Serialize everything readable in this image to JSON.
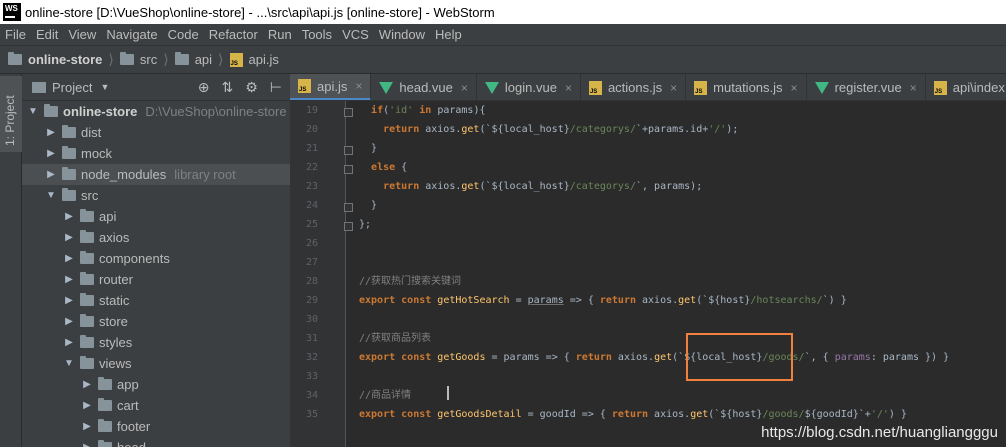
{
  "window": {
    "logo_text": "WS",
    "title": "online-store [D:\\VueShop\\online-store] - ...\\src\\api\\api.js [online-store] - WebStorm"
  },
  "menu": [
    "File",
    "Edit",
    "View",
    "Navigate",
    "Code",
    "Refactor",
    "Run",
    "Tools",
    "VCS",
    "Window",
    "Help"
  ],
  "breadcrumbs": [
    "online-store",
    "src",
    "api",
    "api.js"
  ],
  "sidebar_tab": {
    "label": "1: Project"
  },
  "project_panel": {
    "title": "Project",
    "tree": [
      {
        "label": "online-store",
        "extra": "D:\\VueShop\\online-store",
        "expanded": true,
        "level": 0,
        "bold": true
      },
      {
        "label": "dist",
        "expanded": false,
        "level": 1
      },
      {
        "label": "mock",
        "expanded": false,
        "level": 1
      },
      {
        "label": "node_modules",
        "extra": "library root",
        "expanded": false,
        "level": 1,
        "selected": true
      },
      {
        "label": "src",
        "expanded": true,
        "level": 1
      },
      {
        "label": "api",
        "expanded": false,
        "level": 2
      },
      {
        "label": "axios",
        "expanded": false,
        "level": 2
      },
      {
        "label": "components",
        "expanded": false,
        "level": 2
      },
      {
        "label": "router",
        "expanded": false,
        "level": 2
      },
      {
        "label": "static",
        "expanded": false,
        "level": 2
      },
      {
        "label": "store",
        "expanded": false,
        "level": 2
      },
      {
        "label": "styles",
        "expanded": false,
        "level": 2
      },
      {
        "label": "views",
        "expanded": true,
        "level": 2
      },
      {
        "label": "app",
        "expanded": false,
        "level": 3
      },
      {
        "label": "cart",
        "expanded": false,
        "level": 3
      },
      {
        "label": "footer",
        "expanded": false,
        "level": 3
      },
      {
        "label": "head",
        "expanded": false,
        "level": 3
      }
    ]
  },
  "tabs": [
    {
      "label": "api.js",
      "icon": "js",
      "active": true
    },
    {
      "label": "head.vue",
      "icon": "vue"
    },
    {
      "label": "login.vue",
      "icon": "vue"
    },
    {
      "label": "actions.js",
      "icon": "js"
    },
    {
      "label": "mutations.js",
      "icon": "js"
    },
    {
      "label": "register.vue",
      "icon": "vue"
    },
    {
      "label": "api\\index.js",
      "icon": "js"
    }
  ],
  "editor": {
    "lines": [
      {
        "num": "19",
        "tokens": [
          [
            "",
            "  "
          ],
          [
            "kw",
            "if"
          ],
          [
            "",
            "("
          ],
          [
            "str",
            "'id'"
          ],
          [
            "",
            " "
          ],
          [
            "kw",
            "in"
          ],
          [
            "",
            " params){"
          ]
        ]
      },
      {
        "num": "20",
        "tokens": [
          [
            "",
            "    "
          ],
          [
            "kw",
            "return"
          ],
          [
            "",
            " axios."
          ],
          [
            "fn",
            "get"
          ],
          [
            "",
            "(`${local_host}"
          ],
          [
            "str",
            "/categorys/"
          ],
          [
            "",
            "`+params.id+"
          ],
          [
            "str",
            "'/'"
          ],
          [
            "",
            ");"
          ]
        ]
      },
      {
        "num": "21",
        "tokens": [
          [
            "",
            "  }"
          ]
        ]
      },
      {
        "num": "22",
        "tokens": [
          [
            "",
            "  "
          ],
          [
            "kw",
            "else"
          ],
          [
            "",
            " {"
          ]
        ]
      },
      {
        "num": "23",
        "tokens": [
          [
            "",
            "    "
          ],
          [
            "kw",
            "return"
          ],
          [
            "",
            " axios."
          ],
          [
            "fn",
            "get"
          ],
          [
            "",
            "(`${local_host}"
          ],
          [
            "str",
            "/categorys/"
          ],
          [
            "",
            "`, params);"
          ]
        ]
      },
      {
        "num": "24",
        "tokens": [
          [
            "",
            "  }"
          ]
        ]
      },
      {
        "num": "25",
        "tokens": [
          [
            "",
            "};"
          ]
        ]
      },
      {
        "num": "26",
        "tokens": []
      },
      {
        "num": "27",
        "tokens": []
      },
      {
        "num": "28",
        "tokens": [
          [
            "cm",
            "//获取热门搜索关键词"
          ]
        ]
      },
      {
        "num": "29",
        "tokens": [
          [
            "kw",
            "export"
          ],
          [
            "",
            " "
          ],
          [
            "kw",
            "const"
          ],
          [
            "",
            " "
          ],
          [
            "fn",
            "getHotSearch"
          ],
          [
            "",
            " = "
          ],
          [
            "ul",
            "params"
          ],
          [
            "",
            " => { "
          ],
          [
            "kw",
            "return"
          ],
          [
            "",
            " axios."
          ],
          [
            "fn",
            "get"
          ],
          [
            "",
            "(`${host}"
          ],
          [
            "str",
            "/hotsearchs/"
          ],
          [
            "",
            "`) }"
          ]
        ]
      },
      {
        "num": "30",
        "tokens": []
      },
      {
        "num": "31",
        "tokens": [
          [
            "cm",
            "//获取商品列表"
          ]
        ]
      },
      {
        "num": "32",
        "tokens": [
          [
            "kw",
            "export"
          ],
          [
            "",
            " "
          ],
          [
            "kw",
            "const"
          ],
          [
            "",
            " "
          ],
          [
            "fn",
            "getGoods"
          ],
          [
            "",
            " = params => { "
          ],
          [
            "kw",
            "return"
          ],
          [
            "",
            " axios."
          ],
          [
            "fn",
            "get"
          ],
          [
            "",
            "(`${local_host}"
          ],
          [
            "str",
            "/goods/"
          ],
          [
            "",
            "`, { "
          ],
          [
            "pr",
            "params"
          ],
          [
            "",
            ": params }) }"
          ]
        ]
      },
      {
        "num": "33",
        "tokens": []
      },
      {
        "num": "34",
        "tokens": [
          [
            "cm",
            "//商品详情"
          ]
        ]
      },
      {
        "num": "35",
        "tokens": [
          [
            "kw",
            "export"
          ],
          [
            "",
            " "
          ],
          [
            "kw",
            "const"
          ],
          [
            "",
            " "
          ],
          [
            "fn",
            "getGoodsDetail"
          ],
          [
            "",
            " = goodId => { "
          ],
          [
            "kw",
            "return"
          ],
          [
            "",
            " axios."
          ],
          [
            "fn",
            "get"
          ],
          [
            "",
            "(`${host}"
          ],
          [
            "str",
            "/goods/"
          ],
          [
            "",
            "${goodId}`+"
          ],
          [
            "str",
            "'/'"
          ],
          [
            "",
            ") }"
          ]
        ]
      }
    ]
  },
  "watermark": "https://blog.csdn.net/huangliangggu",
  "colors": {
    "editor_bg": "#2b2b2b",
    "panel_bg": "#3c3f41",
    "keyword": "#cc7832",
    "function": "#ffc66d",
    "string": "#6a8759",
    "comment": "#808080",
    "highlight_box": "#f0803c"
  }
}
